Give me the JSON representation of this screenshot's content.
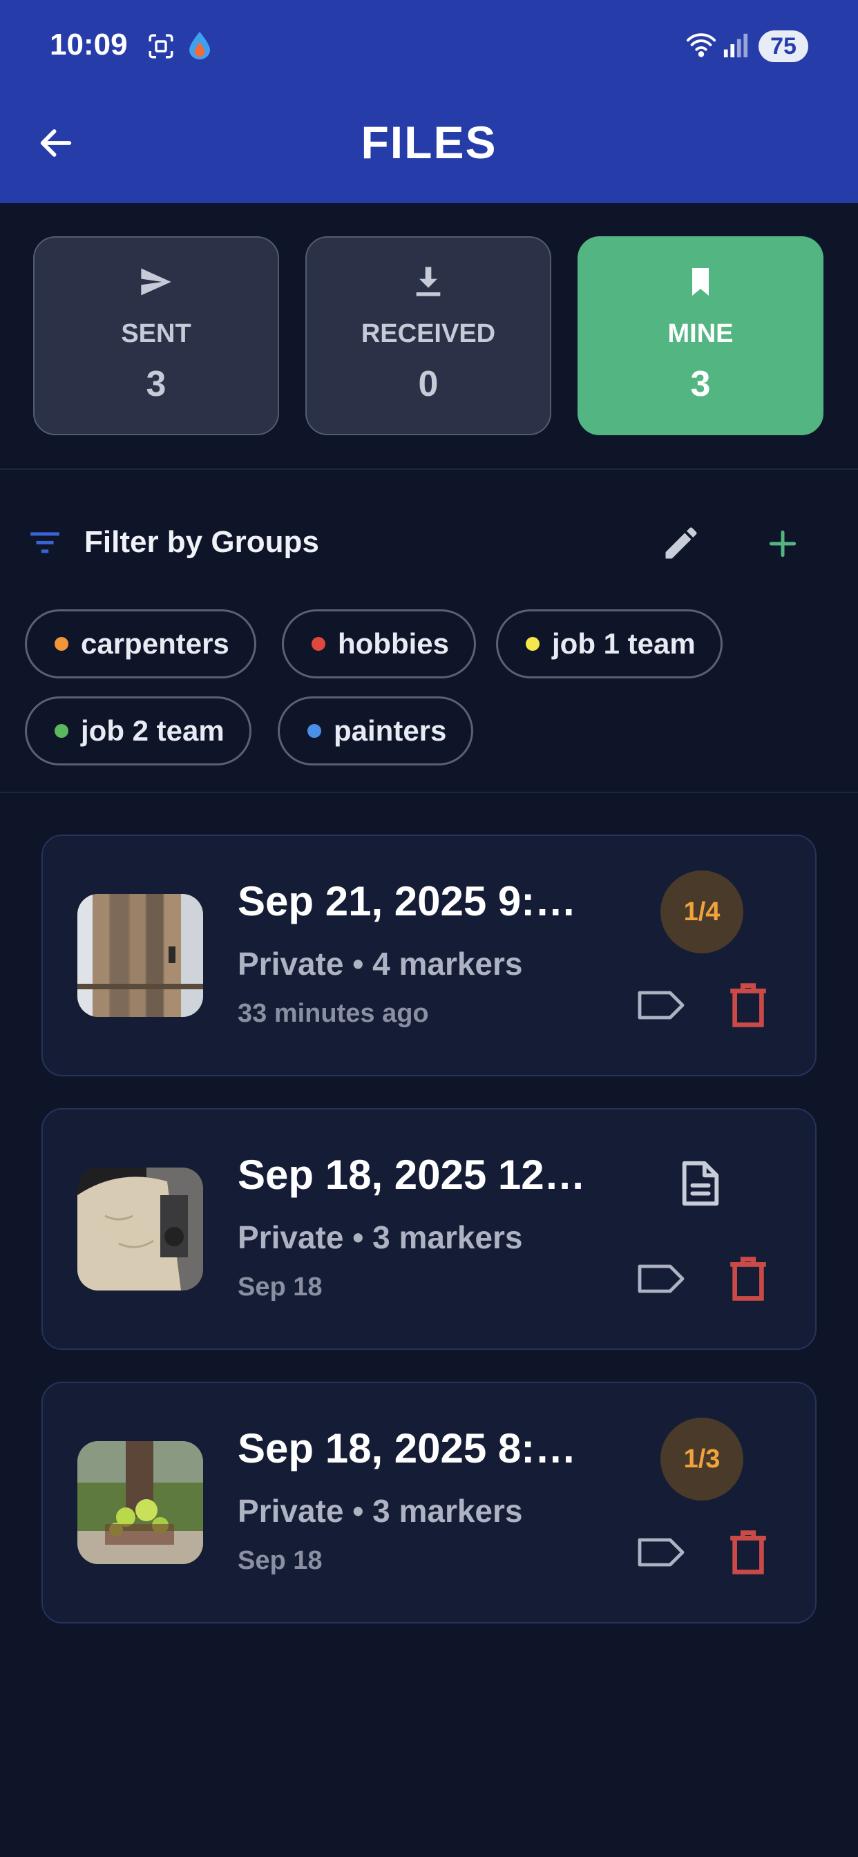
{
  "status_bar": {
    "time": "10:09",
    "battery": "75",
    "icons": [
      "screenshot-icon",
      "drop-icon",
      "wifi-icon",
      "signal-icon"
    ]
  },
  "header": {
    "title": "FILES",
    "back_icon": "arrow-left-icon"
  },
  "stats": [
    {
      "label": "SENT",
      "value": "3",
      "icon": "send-icon",
      "active": false
    },
    {
      "label": "RECEIVED",
      "value": "0",
      "icon": "download-icon",
      "active": false
    },
    {
      "label": "MINE",
      "value": "3",
      "icon": "bookmark-icon",
      "active": true
    }
  ],
  "filter": {
    "title": "Filter by Groups",
    "groups": [
      {
        "label": "carpenters",
        "color": "#f0953a"
      },
      {
        "label": "hobbies",
        "color": "#e0473f"
      },
      {
        "label": "job 1 team",
        "color": "#f4e64b"
      },
      {
        "label": "job 2 team",
        "color": "#5cb85c"
      },
      {
        "label": "painters",
        "color": "#4a8fe8"
      }
    ]
  },
  "files": [
    {
      "title": "Sep 21, 2025 9:…",
      "subtitle": "Private • 4 markers",
      "time": "33 minutes ago",
      "badge": "1/4"
    },
    {
      "title": "Sep 18, 2025 12…",
      "subtitle": "Private • 3 markers",
      "time": "Sep 18",
      "badge": ""
    },
    {
      "title": "Sep 18, 2025 8:…",
      "subtitle": "Private • 3 markers",
      "time": "Sep 18",
      "badge": "1/3"
    }
  ],
  "colors": {
    "header": "#263ca9",
    "background": "#0f1528",
    "active_stat": "#53b682",
    "badge_text": "#f0a33b",
    "delete": "#c94a47",
    "add": "#53b682"
  }
}
